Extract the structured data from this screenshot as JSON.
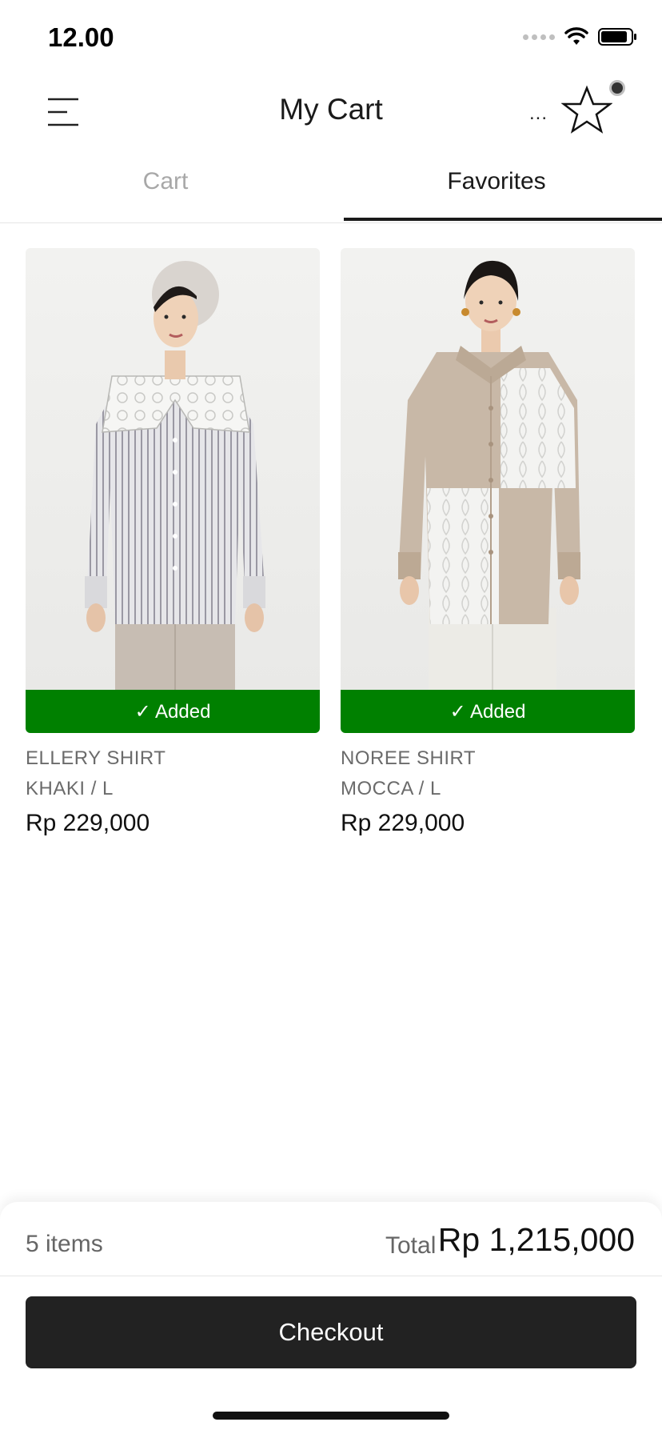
{
  "status_bar": {
    "time": "12.00"
  },
  "header": {
    "title": "My Cart",
    "more_label": "..."
  },
  "tabs": [
    {
      "label": "Cart",
      "active": false
    },
    {
      "label": "Favorites",
      "active": true
    }
  ],
  "products": [
    {
      "name": "ELLERY SHIRT",
      "variant": "KHAKI / L",
      "price": "Rp 229,000",
      "status_label": "✓ Added"
    },
    {
      "name": "NOREE SHIRT",
      "variant": "MOCCA / L",
      "price": "Rp 229,000",
      "status_label": "✓ Added"
    }
  ],
  "summary": {
    "items_count": "5 items",
    "total_label": "Total",
    "total_value": "Rp 1,215,000",
    "checkout_label": "Checkout"
  },
  "colors": {
    "added_green": "#008000",
    "checkout_dark": "#222222",
    "tab_active": "#1a1a1a",
    "tab_inactive": "#a8a8a8"
  }
}
